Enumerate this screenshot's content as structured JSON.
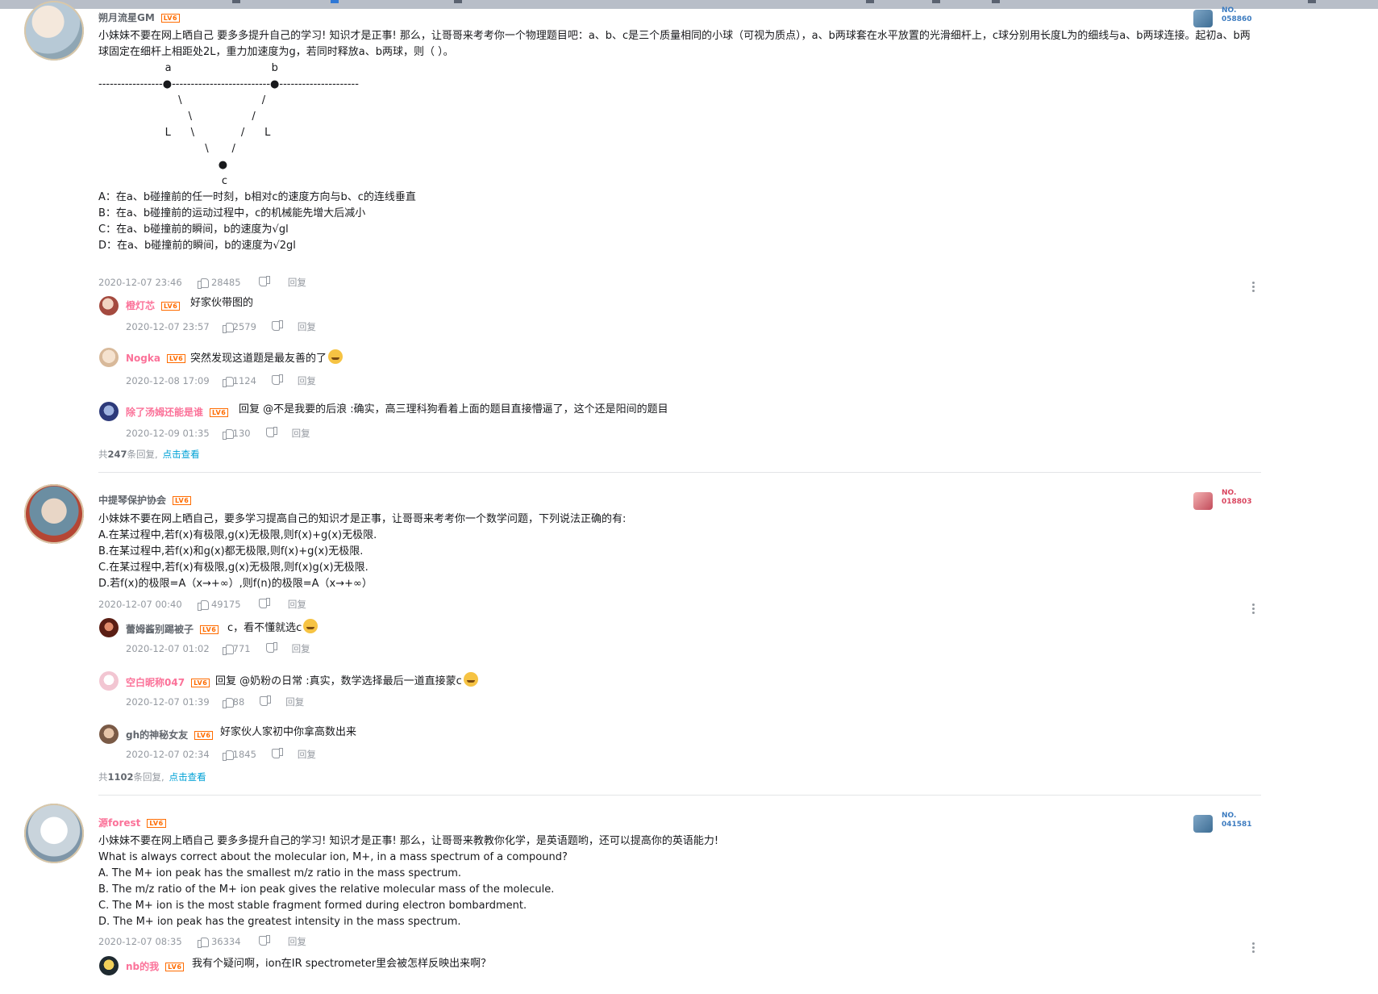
{
  "comments": [
    {
      "user": "朔月流星GM",
      "level": "LV6",
      "badge_no": [
        "NO.",
        "058860"
      ],
      "lines": [
        "小妹妹不要在网上晒自己 要多多提升自己的学习! 知识才是正事! 那么，让哥哥来考考你一个物理题目吧：a、b、c是三个质量相同的小球（可视为质点），a、b两球套在水平放置的光滑细杆上，c球分别用长度L为的细线与a、b两球连接。起初a、b两球固定在细杆上相距处2L，重力加速度为g，若同时释放a、b两球，则（    ）。",
        "",
        "                    a                              b",
        "-----------------●--------------------------●---------------------",
        "                        \\                        /",
        "                           \\                  /",
        "                    L      \\              /      L",
        "                                \\       /",
        "                                    ●",
        "                                     c",
        "A：在a、b碰撞前的任一时刻，b相对c的速度方向与b、c的连线垂直",
        "B：在a、b碰撞前的运动过程中，c的机械能先增大后减小",
        "C：在a、b碰撞前的瞬间，b的速度为√gl",
        "D：在a、b碰撞前的瞬间，b的速度为√2gl"
      ],
      "time": "2020-12-07 23:46",
      "likes": "28485",
      "reply_label": "回复",
      "replies": [
        {
          "user": "橙灯芯",
          "level": "LV6",
          "text": "好家伙带图的",
          "time": "2020-12-07 23:57",
          "likes": "2579"
        },
        {
          "user": "Nogka",
          "level": "LV6",
          "text": "突然发现这道题是最友善的了",
          "time": "2020-12-08 17:09",
          "likes": "1124"
        },
        {
          "user": "除了汤姆还能是谁",
          "level": "LV6",
          "text": "回复 @不是我要的后浪 :确实，高三理科狗看着上面的题目直接懵逼了，这个还是阳间的题目",
          "time": "2020-12-09 01:35",
          "likes": "130"
        }
      ],
      "total": {
        "prefix": "共",
        "count": "247",
        "suffix": "条回复,",
        "link": "点击查看"
      }
    },
    {
      "user": "中提琴保护协会",
      "level": "LV6",
      "badge_no": [
        "NO.",
        "018803"
      ],
      "lines": [
        "小妹妹不要在网上晒自己，要多学习提高自己的知识才是正事，让哥哥来考考你一个数学问题，下列说法正确的有:",
        "A.在某过程中,若f(x)有极限,g(x)无极限,则f(x)+g(x)无极限.",
        "B.在某过程中,若f(x)和g(x)都无极限,则f(x)+g(x)无极限.",
        "C.在某过程中,若f(x)有极限,g(x)无极限,则f(x)g(x)无极限.",
        "D.若f(x)的极限=A（x→+∞）,则f(n)的极限=A（x→+∞）"
      ],
      "time": "2020-12-07 00:40",
      "likes": "49175",
      "reply_label": "回复",
      "replies": [
        {
          "user": "蕾姆酱别踢被子",
          "level": "LV6",
          "text": "c，看不懂就选c",
          "time": "2020-12-07 01:02",
          "likes": "771"
        },
        {
          "user": "空白昵称047",
          "level": "LV6",
          "text": "回复 @奶粉の日常 :真实，数学选择最后一道直接蒙c",
          "time": "2020-12-07 01:39",
          "likes": "88"
        },
        {
          "user": "gh的神秘女友",
          "level": "LV6",
          "text": "好家伙人家初中你拿高数出来",
          "time": "2020-12-07 02:34",
          "likes": "1845"
        }
      ],
      "total": {
        "prefix": "共",
        "count": "1102",
        "suffix": "条回复,",
        "link": "点击查看"
      }
    },
    {
      "user": "源forest",
      "level": "LV6",
      "badge_no": [
        "NO.",
        "041581"
      ],
      "lines": [
        "小妹妹不要在网上晒自己 要多多提升自己的学习! 知识才是正事! 那么，让哥哥来教教你化学，是英语题哟，还可以提高你的英语能力!",
        "What is always correct about the molecular ion, M+, in a mass spectrum of a compound?",
        "A. The M+ ion peak has the smallest m/z ratio in the mass spectrum.",
        "B. The m/z ratio of the M+ ion peak gives the relative molecular mass of the molecule.",
        "C. The M+ ion is the most stable fragment formed during electron bombardment.",
        "D. The M+ ion peak has the greatest intensity in the mass spectrum."
      ],
      "time": "2020-12-07 08:35",
      "likes": "36334",
      "reply_label": "回复",
      "replies": [
        {
          "user": "nb的我",
          "level": "LV6",
          "text": "我有个疑问啊，ion在IR spectrometer里会被怎样反映出来啊？"
        }
      ]
    }
  ]
}
